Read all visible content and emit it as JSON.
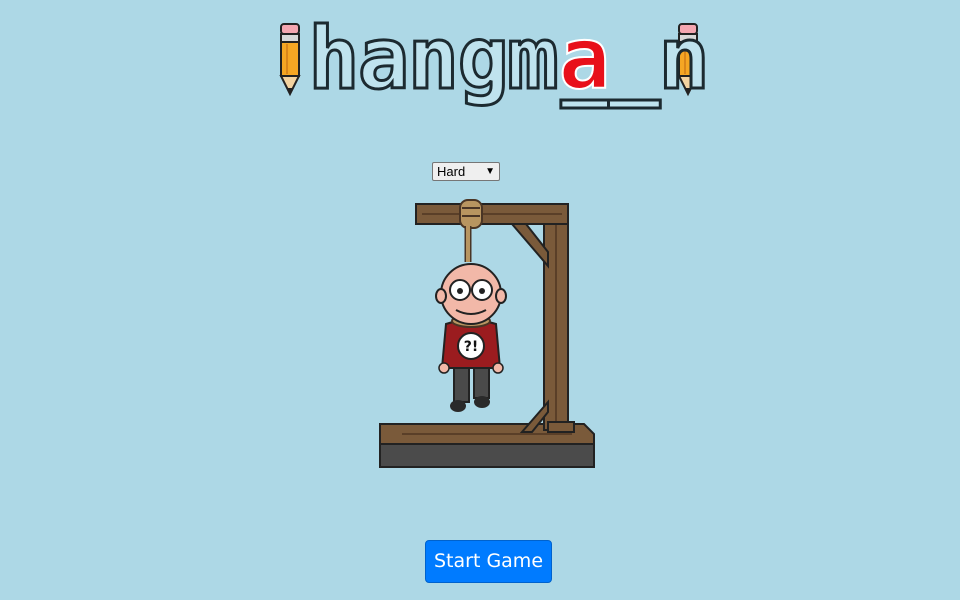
{
  "title": {
    "letters_before": "hangm",
    "revealed_letter": "a",
    "blank_char": "_",
    "letters_after": "n",
    "revealed_color": "#e8101a",
    "letter_fill": "#bfe3ee",
    "letter_stroke": "#1c2a30"
  },
  "difficulty": {
    "selected": "Hard",
    "arrow_glyph": "▼"
  },
  "figure": {
    "shirt_mark": "?!"
  },
  "start_button": {
    "label": "Start Game"
  },
  "colors": {
    "background": "#add8e6",
    "wood": "#7a5a3a",
    "wood_dark": "#4a3525",
    "rope": "#b89560",
    "shirt": "#9b1c1f",
    "skin": "#f2b8a8",
    "pants": "#4a4a4a",
    "button": "#007bff"
  }
}
